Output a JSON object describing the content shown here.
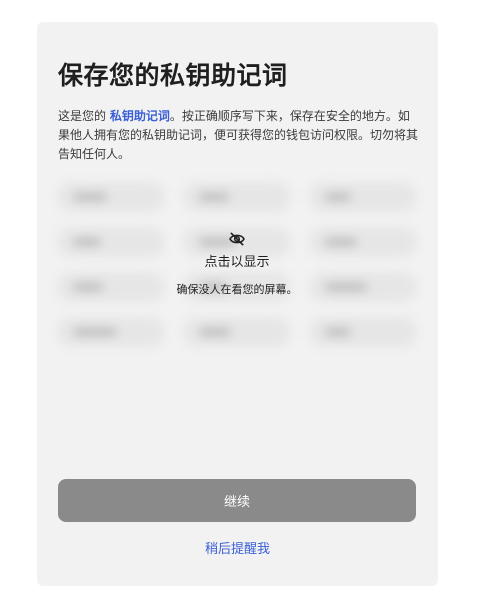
{
  "title": "保存您的私钥助记词",
  "description": {
    "prefix": "这是您的 ",
    "link": "私钥助记词",
    "suffix": "。按正确顺序写下来，保存在安全的地方。如果他人拥有您的私钥助记词，便可获得您的钱包访问权限。切勿将其告知任何人。"
  },
  "reveal": {
    "icon": "eye-off-icon",
    "title": "点击以显示",
    "subtitle": "确保没人在看您的屏幕。"
  },
  "buttons": {
    "continue": "继续",
    "remind_later": "稍后提醒我"
  },
  "colors": {
    "card_bg": "#f2f2f2",
    "button_bg": "#8a8a8a",
    "link": "#3a5fd6"
  }
}
